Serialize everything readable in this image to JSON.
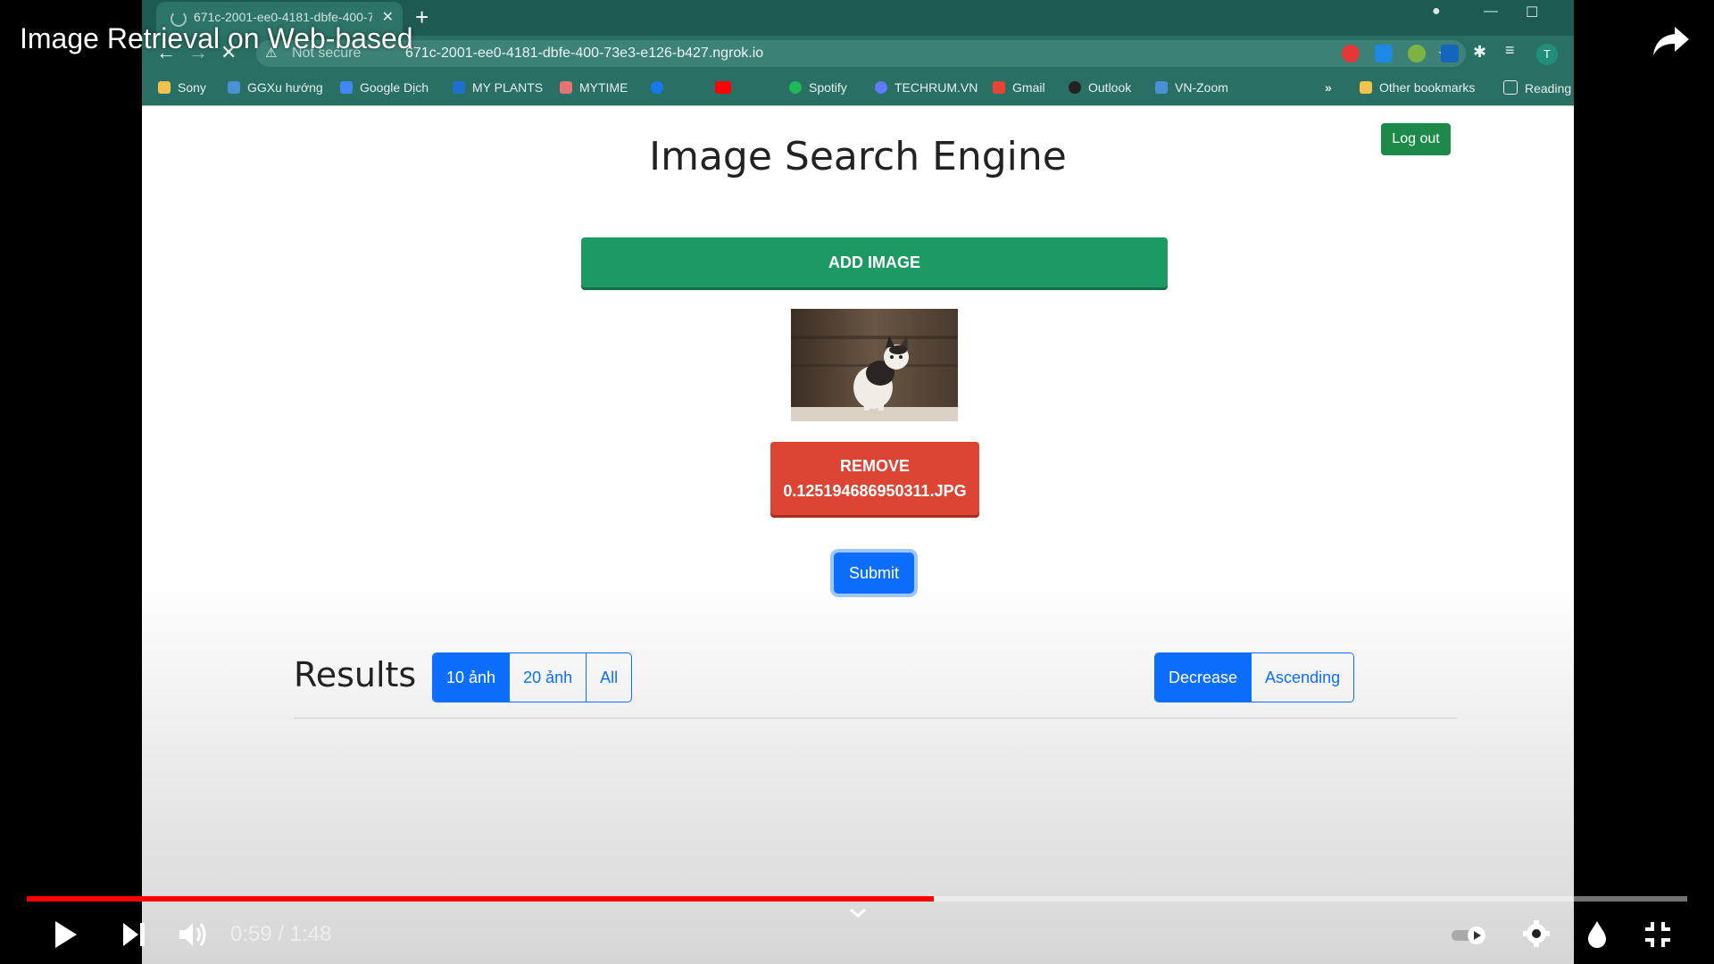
{
  "video": {
    "title": "Image Retrieval on Web-based",
    "time_current": "0:59",
    "time_separator": "/",
    "time_total": "1:48",
    "progress_fraction": 0.546
  },
  "browser": {
    "tab_title": "671c-2001-ee0-4181-dbfe-400-7",
    "not_secure": "Not secure",
    "url": "671c-2001-ee0-4181-dbfe-400-73e3-e126-b427.ngrok.io",
    "avatar_letter": "T",
    "bookmarks": [
      {
        "label": "Sony",
        "color": "#f2c14e"
      },
      {
        "label": "GGXu hướng",
        "color": "#4a90d9"
      },
      {
        "label": "Google Dịch",
        "color": "#4285f4"
      },
      {
        "label": "MY PLANTS",
        "color": "#1f6fd1"
      },
      {
        "label": "MYTIME",
        "color": "#e57373"
      },
      {
        "label": "",
        "color": "#1877f2"
      },
      {
        "label": "",
        "color": "#ff0000"
      },
      {
        "label": "Spotify",
        "color": "#1db954"
      },
      {
        "label": "TECHRUM.VN",
        "color": "#5c7cfa"
      },
      {
        "label": "Gmail",
        "color": "#ea4335"
      },
      {
        "label": "Outlook",
        "color": "#222222"
      },
      {
        "label": "VN-Zoom",
        "color": "#4a90d9"
      }
    ],
    "more_bookmarks": "»",
    "other_bookmarks": "Other bookmarks",
    "reading_list": "Reading"
  },
  "page": {
    "logout_label": "Log out",
    "heading": "Image Search Engine",
    "add_image_label": "ADD IMAGE",
    "remove_line1": "REMOVE",
    "remove_line2": "0.125194686950311.JPG",
    "submit_label": "Submit",
    "results_title": "Results",
    "count_options": [
      "10 ảnh",
      "20 ảnh",
      "All"
    ],
    "count_selected": "10 ảnh",
    "sort_options": [
      "Decrease",
      "Ascending"
    ],
    "sort_selected": "Decrease"
  },
  "colors": {
    "accent_blue": "#0d6efd",
    "add_green": "#1d9a64",
    "remove_red": "#dc4433",
    "logout_green": "#1e8a49",
    "progress_red": "#ff0000"
  }
}
